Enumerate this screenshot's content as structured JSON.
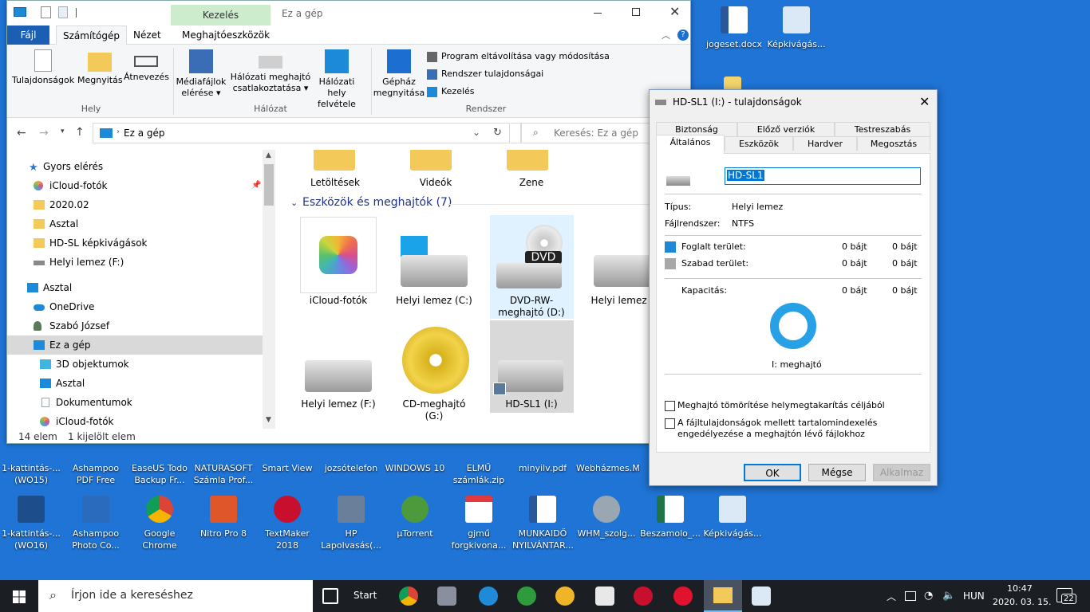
{
  "desktop_icons": [
    {
      "label": "jogeset.docx",
      "color": "#2b579a"
    },
    {
      "label": "Képkivágás...",
      "color": "#dbe9f7"
    },
    {
      "label": "1-kattintás-... (WO15)",
      "color": "#1e4d8c"
    },
    {
      "label": "Ashampoo PDF Free",
      "color": "#e03a3e"
    },
    {
      "label": "EaseUS Todo Backup Fr...",
      "color": "#2c6bd6"
    },
    {
      "label": "NATURASOFT Számla Prof...",
      "color": "#e8b23a"
    },
    {
      "label": "Smart View",
      "color": "#4a90d9"
    },
    {
      "label": "jozsótelefon",
      "color": "#f3d36b"
    },
    {
      "label": "WINDOWS 10",
      "color": "#f3d36b"
    },
    {
      "label": "ELMŰ számlák.zip",
      "color": "#7fb24a"
    },
    {
      "label": "minyilv.pdf",
      "color": "#e03a3e"
    },
    {
      "label": "Webházmes...",
      "color": "#dbe9f7"
    },
    {
      "label": "M",
      "color": "#dbe9f7"
    },
    {
      "label": "1-kattintás-... (WO16)",
      "color": "#1e4d8c"
    },
    {
      "label": "Ashampoo Photo Co...",
      "color": "#2a6bbd"
    },
    {
      "label": "Google Chrome",
      "color": "#f0b429"
    },
    {
      "label": "Nitro Pro 8",
      "color": "#e0562b"
    },
    {
      "label": "TextMaker 2018",
      "color": "#c8102e"
    },
    {
      "label": "HP Lapolvasás(...",
      "color": "#6a7f99"
    },
    {
      "label": "µTorrent",
      "color": "#4d9a3c"
    },
    {
      "label": "gjmű forgkivona...",
      "color": "#e03a3e"
    },
    {
      "label": "MUNKAIDŐ NYILVÁNTAR...",
      "color": "#2b579a"
    },
    {
      "label": "WHM_szolg...",
      "color": "#9aa7b3"
    },
    {
      "label": "Beszamolo_...",
      "color": "#217346"
    },
    {
      "label": "Képkivágás...",
      "color": "#dbe9f7"
    }
  ],
  "explorer": {
    "title": "Ez a gép",
    "context_tab": "Kezelés",
    "tabs": {
      "file": "Fájl",
      "computer": "Számítógép",
      "view": "Nézet",
      "drive_tools": "Meghajtóeszközök"
    },
    "ribbon": {
      "properties": "Tulajdonságok",
      "open": "Megnyitás",
      "rename": "Átnevezés",
      "group_location": "Hely",
      "media": "Médiafájlok elérése",
      "map_drive": "Hálózati meghajtó csatlakoztatása",
      "net_location": "Hálózati hely felvétele",
      "group_network": "Hálózat",
      "open_settings": "Gépház megnyitása",
      "uninstall": "Program eltávolítása vagy módosítása",
      "sys_props": "Rendszer tulajdonságai",
      "manage": "Kezelés",
      "group_system": "Rendszer"
    },
    "address": "Ez a gép",
    "search_placeholder": "Keresés: Ez a gép",
    "nav": [
      {
        "label": "Gyors elérés",
        "color": "#2b77d0"
      },
      {
        "label": "iCloud-fotók",
        "color": "#e9a23b"
      },
      {
        "label": "2020.02",
        "color": "#f3c95a"
      },
      {
        "label": "Asztal",
        "color": "#f3c95a"
      },
      {
        "label": "HD-SL képkivágások",
        "color": "#f3c95a"
      },
      {
        "label": "Helyi lemez (F:)",
        "color": "#888"
      },
      {
        "label": "Asztal",
        "color": "#1c8ad8"
      },
      {
        "label": "OneDrive",
        "color": "#1c8ad8"
      },
      {
        "label": "Szabó József",
        "color": "#5b7a5b"
      },
      {
        "label": "Ez a gép",
        "color": "#1c8ad8"
      },
      {
        "label": "3D objektumok",
        "color": "#3fb5e0"
      },
      {
        "label": "Asztal",
        "color": "#1c8ad8"
      },
      {
        "label": "Dokumentumok",
        "color": "#9aa7b3"
      },
      {
        "label": "iCloud-fotók",
        "color": "#e9a23b"
      }
    ],
    "folders": [
      "Letöltések",
      "Videók",
      "Zene"
    ],
    "section_header": "Eszközök és meghajtók (7)",
    "drives": [
      "iCloud-fotók",
      "Helyi lemez (C:)",
      "DVD-RW-meghajtó (D:)",
      "Helyi lemez (E:)",
      "Helyi lemez (F:)",
      "CD-meghajtó (G:)",
      "HD-SL1 (I:)"
    ],
    "dvd_badge": "DVD",
    "status_count": "14 elem",
    "status_selected": "1 kijelölt elem"
  },
  "dialog": {
    "title": "HD-SL1 (I:) - tulajdonságok",
    "tabs": [
      "Biztonság",
      "Előző verziók",
      "Testreszabás",
      "Általános",
      "Eszközök",
      "Hardver",
      "Megosztás"
    ],
    "name_value": "HD-SL1",
    "type_label": "Típus:",
    "type_value": "Helyi lemez",
    "fs_label": "Fájlrendszer:",
    "fs_value": "NTFS",
    "used_label": "Foglalt terület:",
    "used_bytes": "0 bájt",
    "used_size": "0 bájt",
    "free_label": "Szabad terület:",
    "free_bytes": "0 bájt",
    "free_size": "0 bájt",
    "cap_label": "Kapacitás:",
    "cap_bytes": "0 bájt",
    "cap_size": "0 bájt",
    "drive_label": "I: meghajtó",
    "compress": "Meghajtó tömörítése helymegtakarítás céljából",
    "index": "A fájltulajdonságok mellett tartalomindexelés engedélyezése a meghajtón lévő fájlokhoz",
    "ok": "OK",
    "cancel": "Mégse",
    "apply": "Alkalmaz",
    "used_color": "#1e88d8",
    "free_color": "#a8a8a8"
  },
  "taskbar": {
    "search": "Írjon ide a kereséshez",
    "start": "Start",
    "lang": "HUN",
    "time": "10:47",
    "date": "2020. 03. 15.",
    "notif": "22"
  }
}
